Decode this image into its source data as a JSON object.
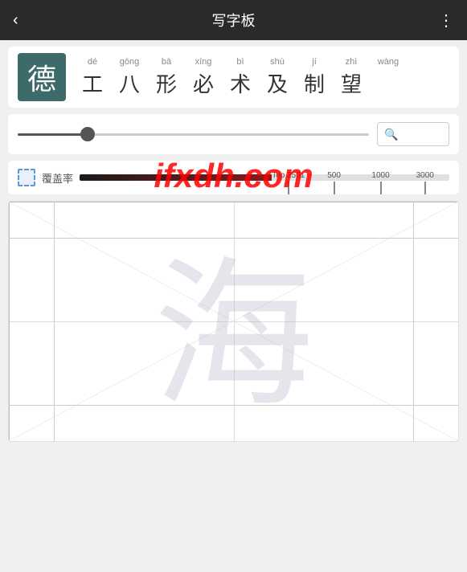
{
  "header": {
    "title": "写字板",
    "back_icon": "‹",
    "menu_icon": "⋮"
  },
  "char_card": {
    "char": "德",
    "bg_color": "#3d6b6b"
  },
  "char_list": {
    "items": [
      {
        "pinyin": "dé",
        "hanzi": "工"
      },
      {
        "pinyin": "gōng",
        "hanzi": "八"
      },
      {
        "pinyin": "bā",
        "hanzi": "形"
      },
      {
        "pinyin": "xíng",
        "hanzi": "必"
      },
      {
        "pinyin": "bì",
        "hanzi": "术"
      },
      {
        "pinyin": "shù",
        "hanzi": "及"
      },
      {
        "pinyin": "jí",
        "hanzi": "制"
      },
      {
        "pinyin": "zhì",
        "hanzi": "望"
      },
      {
        "pinyin": "wàng",
        "hanzi": ""
      }
    ]
  },
  "controls": {
    "search_placeholder": "🔍"
  },
  "coverage": {
    "label": "覆盖率",
    "markers": [
      {
        "label": "Top 2501",
        "position": 52
      },
      {
        "label": "500",
        "position": 67
      },
      {
        "label": "1000",
        "position": 79
      },
      {
        "label": "3000",
        "position": 91
      }
    ]
  },
  "watermark": {
    "text": "ifxdh.com"
  },
  "writing": {
    "bg_char": "海"
  }
}
